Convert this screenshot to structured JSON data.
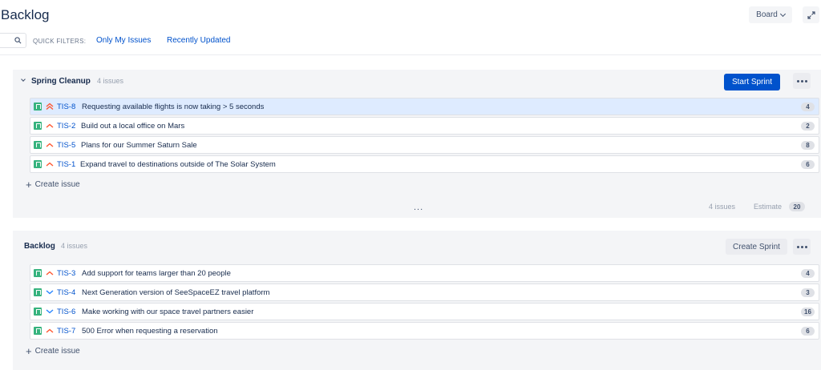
{
  "header": {
    "title": "Backlog",
    "board_label": "Board"
  },
  "filters": {
    "label": "QUICK FILTERS:",
    "items": [
      "Only My Issues",
      "Recently Updated"
    ]
  },
  "sprint": {
    "name": "Spring Cleanup",
    "count": "4 issues",
    "start_label": "Start Sprint",
    "issues": [
      {
        "key": "TIS-8",
        "summary": "Requesting available flights is now taking > 5 seconds",
        "estimate": "4",
        "priority": "highest"
      },
      {
        "key": "TIS-2",
        "summary": "Build out a local office on Mars",
        "estimate": "2",
        "priority": "high"
      },
      {
        "key": "TIS-5",
        "summary": "Plans for our Summer Saturn Sale",
        "estimate": "8",
        "priority": "high"
      },
      {
        "key": "TIS-1",
        "summary": "Expand travel to destinations outside of The Solar System",
        "estimate": "6",
        "priority": "high"
      }
    ],
    "create_label": "Create issue",
    "footer_issues": "4 issues",
    "footer_estimate_label": "Estimate",
    "footer_estimate_value": "20"
  },
  "backlog": {
    "name": "Backlog",
    "count": "4 issues",
    "create_sprint_label": "Create Sprint",
    "issues": [
      {
        "key": "TIS-3",
        "summary": "Add support for teams larger than 20 people",
        "estimate": "4",
        "priority": "high"
      },
      {
        "key": "TIS-4",
        "summary": "Next Generation version of SeeSpaceEZ travel platform",
        "estimate": "3",
        "priority": "low"
      },
      {
        "key": "TIS-6",
        "summary": "Make working with our space travel partners easier",
        "estimate": "16",
        "priority": "low"
      },
      {
        "key": "TIS-7",
        "summary": "500 Error when requesting a reservation",
        "estimate": "6",
        "priority": "high"
      }
    ],
    "create_label": "Create issue"
  },
  "colors": {
    "primary": "#0052cc",
    "story_green": "#36b37e",
    "priority_high": "#ff5630",
    "priority_low": "#2684ff",
    "selected_row": "#deebff"
  },
  "icons": {
    "issue_type": "story-icon",
    "priority_highest": "double-chevron-up-icon",
    "priority_high": "chevron-up-icon",
    "priority_low": "chevron-down-icon"
  }
}
